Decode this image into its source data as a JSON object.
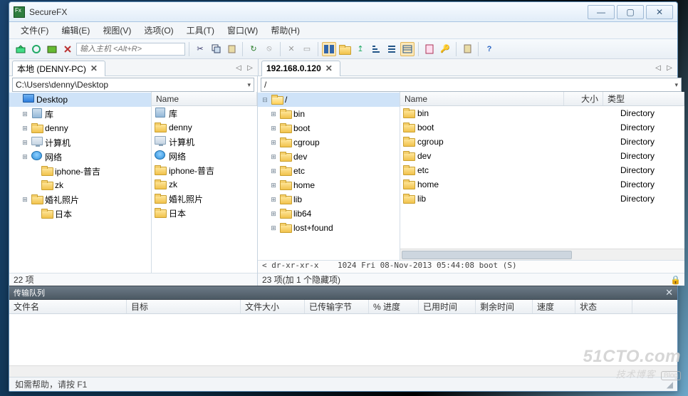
{
  "title": "SecureFX",
  "menus": [
    "文件(F)",
    "编辑(E)",
    "视图(V)",
    "选项(O)",
    "工具(T)",
    "窗口(W)",
    "帮助(H)"
  ],
  "toolbar": {
    "hostInputPlaceholder": "输入主机 <Alt+R>"
  },
  "tabs": {
    "local": "本地 (DENNY-PC)",
    "remote": "192.168.0.120"
  },
  "local": {
    "path": "C:\\Users\\denny\\Desktop",
    "tree": [
      {
        "label": "Desktop",
        "icon": "desktop",
        "exp": "",
        "sel": true,
        "lvl": 0
      },
      {
        "label": "库",
        "icon": "lib",
        "exp": "+",
        "lvl": 1
      },
      {
        "label": "denny",
        "icon": "folder",
        "exp": "+",
        "lvl": 1
      },
      {
        "label": "计算机",
        "icon": "pc",
        "exp": "+",
        "lvl": 1
      },
      {
        "label": "网络",
        "icon": "net",
        "exp": "+",
        "lvl": 1
      },
      {
        "label": "iphone-普吉",
        "icon": "folder",
        "exp": "",
        "lvl": 2
      },
      {
        "label": "zk",
        "icon": "folder",
        "exp": "",
        "lvl": 2
      },
      {
        "label": "婚礼照片",
        "icon": "folder",
        "exp": "+",
        "lvl": 1
      },
      {
        "label": "日本",
        "icon": "folder",
        "exp": "",
        "lvl": 2
      }
    ],
    "columns": [
      "Name"
    ],
    "rows": [
      "库",
      "denny",
      "计算机",
      "网络",
      "iphone-普吉",
      "zk",
      "婚礼照片",
      "日本"
    ],
    "rowIcons": [
      "lib",
      "folder",
      "pc",
      "net",
      "folder",
      "folder",
      "folder",
      "folder"
    ],
    "status": "22 项"
  },
  "remote": {
    "path": "/",
    "tree": [
      {
        "label": "/",
        "icon": "fopen",
        "exp": "-",
        "lvl": 0,
        "sel": true
      },
      {
        "label": "bin",
        "icon": "folder",
        "exp": "+",
        "lvl": 1
      },
      {
        "label": "boot",
        "icon": "folder",
        "exp": "+",
        "lvl": 1
      },
      {
        "label": "cgroup",
        "icon": "folder",
        "exp": "+",
        "lvl": 1
      },
      {
        "label": "dev",
        "icon": "folder",
        "exp": "+",
        "lvl": 1
      },
      {
        "label": "etc",
        "icon": "folder",
        "exp": "+",
        "lvl": 1
      },
      {
        "label": "home",
        "icon": "folder",
        "exp": "+",
        "lvl": 1
      },
      {
        "label": "lib",
        "icon": "folder",
        "exp": "+",
        "lvl": 1
      },
      {
        "label": "lib64",
        "icon": "folder",
        "exp": "+",
        "lvl": 1
      },
      {
        "label": "lost+found",
        "icon": "folder",
        "exp": "+",
        "lvl": 1
      }
    ],
    "columns": {
      "name": "Name",
      "size": "大小",
      "type": "类型"
    },
    "rows": [
      {
        "name": "bin",
        "type": "Directory"
      },
      {
        "name": "boot",
        "type": "Directory"
      },
      {
        "name": "cgroup",
        "type": "Directory"
      },
      {
        "name": "dev",
        "type": "Directory"
      },
      {
        "name": "etc",
        "type": "Directory"
      },
      {
        "name": "home",
        "type": "Directory"
      },
      {
        "name": "lib",
        "type": "Directory"
      }
    ],
    "log": "< dr-xr-xr-x    1024 Fri 08-Nov-2013 05:44:08 boot (S)",
    "status": "23 项(加 1 个隐藏项)"
  },
  "queue": {
    "title": "传输队列",
    "columns": [
      "文件名",
      "目标",
      "文件大小",
      "已传输字节",
      "% 进度",
      "已用时间",
      "剩余时间",
      "速度",
      "状态"
    ]
  },
  "statusbar": "如需帮助，请按 F1",
  "watermark": {
    "line1": "51CTO.com",
    "line2": "技术博客",
    "blog": "Blog"
  }
}
